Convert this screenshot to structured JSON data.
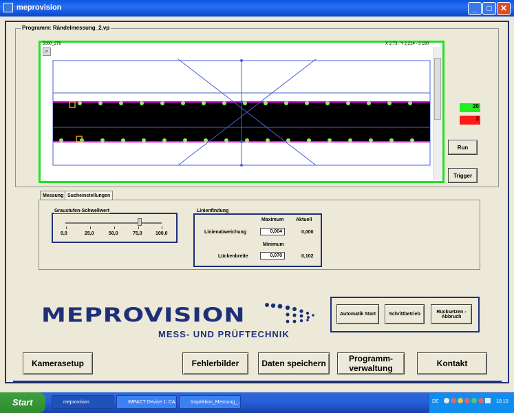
{
  "window": {
    "title": "meprovision"
  },
  "program": {
    "label": "Programm:  Rändelmessung_2.vp"
  },
  "camera": {
    "top_left": "5000_276",
    "top_right": "X 2,73 , Y 2,214 - 3 180"
  },
  "counters": {
    "ok": "20",
    "nok": "3",
    "ok_color": "#22ee22",
    "nok_color": "#ff1a1a"
  },
  "buttons": {
    "run": "Run",
    "trigger": "Trigger"
  },
  "tabs": [
    {
      "label": "Messung"
    },
    {
      "label": "Sucheinstellungen"
    }
  ],
  "graustufen": {
    "title": "Graustufen-Schwellwert",
    "ticks": [
      "0,0",
      "25,0",
      "50,0",
      "75,0",
      "100,0"
    ],
    "value": 77
  },
  "linienfindung": {
    "title": "Linienfindung",
    "col_max": "Maximum",
    "col_akt": "Aktuell",
    "row1_label": "Linienabweichung",
    "row1_max": "0,004",
    "row1_akt": "0,000",
    "min_header": "Minimum",
    "row2_label": "Lückenbreite",
    "row2_min": "0,070",
    "row2_akt": "0,102"
  },
  "logo": {
    "brand": "MEPROVISION",
    "sub": "MESS- UND PRÜFTECHNIK"
  },
  "auto_buttons": {
    "auto_start": "Automatik Start",
    "schritt": "Schrittbetrieb",
    "reset": "Rücksetzen - Abbruch"
  },
  "bottom_buttons": {
    "kamera": "Kamerasetup",
    "fehler": "Fehlerbilder",
    "daten": "Daten speichern",
    "programm": "Programm-verwaltung",
    "kontakt": "Kontakt"
  },
  "taskbar": {
    "start": "Start",
    "tasks": [
      "meprovision",
      "IMPACT Device 1: CA...",
      "Inspektion_Messung_..."
    ],
    "lang": "DE",
    "time": "10:10"
  }
}
